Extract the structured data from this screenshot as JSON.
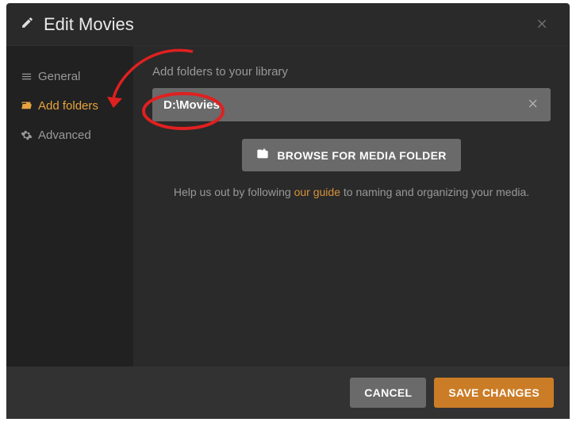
{
  "header": {
    "title": "Edit Movies"
  },
  "sidebar": {
    "items": [
      {
        "label": "General"
      },
      {
        "label": "Add folders"
      },
      {
        "label": "Advanced"
      }
    ]
  },
  "main": {
    "section_label": "Add folders to your library",
    "folder_path": "D:\\Movies",
    "browse_button": "BROWSE FOR MEDIA FOLDER",
    "help_prefix": "Help us out by following ",
    "help_link": "our guide",
    "help_suffix": " to naming and organizing your media."
  },
  "footer": {
    "cancel": "CANCEL",
    "save": "SAVE CHANGES"
  }
}
